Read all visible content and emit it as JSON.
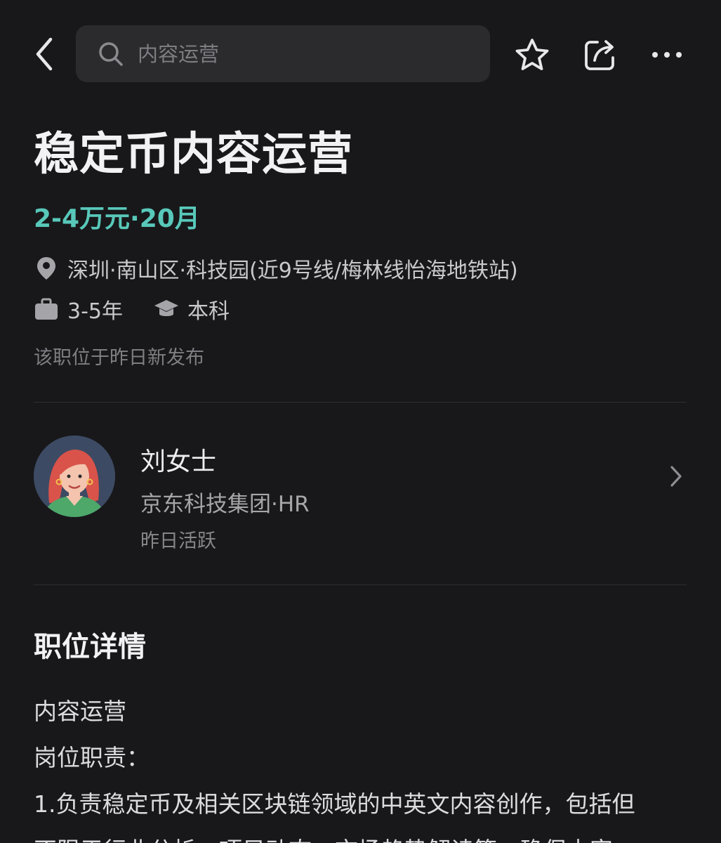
{
  "header": {
    "search_placeholder": "内容运营",
    "icons": [
      "back-icon",
      "search-icon",
      "star-icon",
      "share-icon",
      "more-icon"
    ]
  },
  "job": {
    "title": "稳定币内容运营",
    "salary": "2-4万元·20月",
    "location": "深圳·南山区·科技园(近9号线/梅林线怡海地铁站)",
    "experience": "3-5年",
    "education": "本科",
    "posted": "该职位于昨日新发布"
  },
  "recruiter": {
    "name": "刘女士",
    "company": "京东科技集团·HR",
    "activity": "昨日活跃"
  },
  "details": {
    "section_title": "职位详情",
    "lines": [
      "内容运营",
      "岗位职责：",
      "1.负责稳定币及相关区块链领域的中英文内容创作，包括但",
      "不限于行业分析、项目动态、市场趋势解读等，确保内容"
    ]
  },
  "colors": {
    "background": "#18181a",
    "accent_salary": "#58c8ba",
    "search_bg": "#2b2b2e"
  }
}
